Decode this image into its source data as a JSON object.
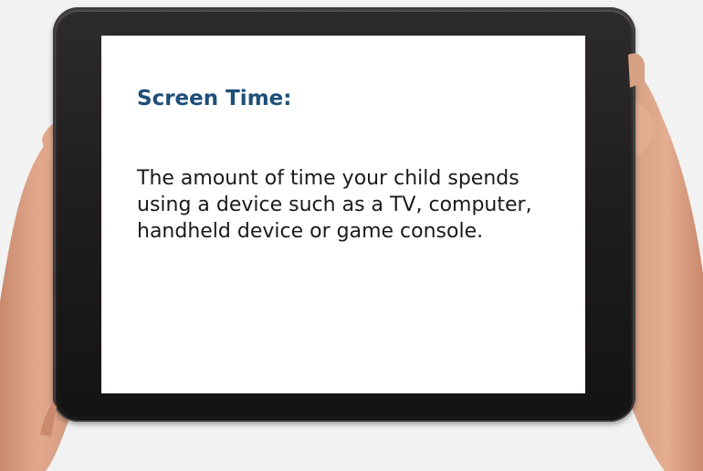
{
  "screen": {
    "title": "Screen Time:",
    "body": "The amount of time your child spends using a device such as a TV, computer, handheld device or game console."
  },
  "colors": {
    "background": "#f2f2f2",
    "title": "#1f4e79",
    "body_text": "#1a1a1a",
    "tablet_frame": "#1e1c1c",
    "screen": "#ffffff"
  }
}
